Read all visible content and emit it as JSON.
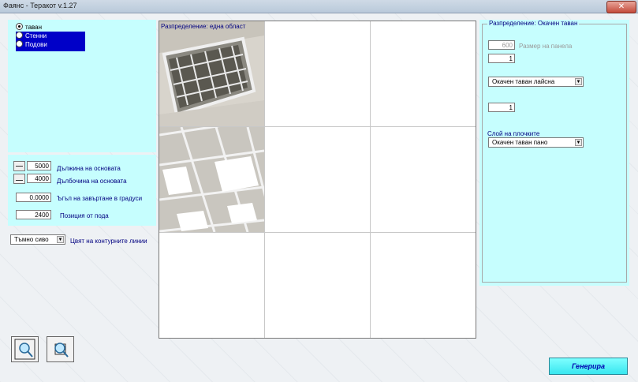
{
  "window": {
    "title": "Фаянс - Теракот v.1.27",
    "close_glyph": "✕"
  },
  "surfaces": [
    {
      "label": "таван",
      "selected": true
    },
    {
      "label": "Стенни",
      "selected": false
    },
    {
      "label": "Подови",
      "selected": false
    }
  ],
  "dimensions": {
    "length_value": "5000",
    "length_label": "Дължина на основата",
    "depth_value": "4000",
    "depth_label": "Дълбочина на основата",
    "angle_value": "0.0000",
    "angle_label": "Ъгъл на завъртане в градуси",
    "height_value": "2400",
    "height_label": "Позиция от пода"
  },
  "contour": {
    "color_value": "Тъмно сиво",
    "color_label": "Цвят на контурните линии"
  },
  "grid": {
    "caption": "Разпределение: една област"
  },
  "settings": {
    "group_title": "Разпределение: Окачен таван",
    "panel_size_value": "600",
    "panel_size_label": "Размер на панела",
    "field2_value": "1",
    "profile_select": "Окачен таван лайсна",
    "field3_value": "1",
    "tiles_layer_label": "Слой на плочките",
    "tiles_layer_select": "Окачен таван пано"
  },
  "actions": {
    "generate_label": "Генерира"
  },
  "colors": {
    "panel": "#c6fefe",
    "selection": "#0000c8",
    "accent": "#38e6ef"
  }
}
